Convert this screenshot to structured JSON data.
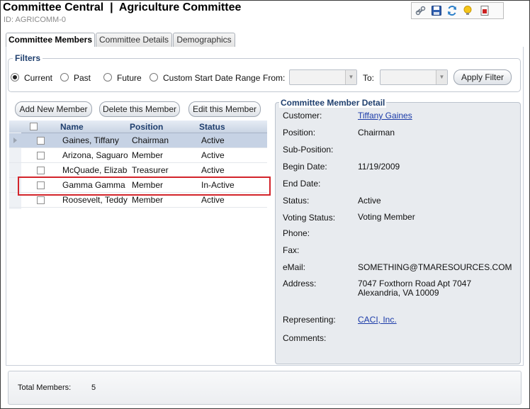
{
  "header": {
    "title": "Committee Central  |  Agriculture Committee",
    "id_text": "ID: AGRICOMM-0"
  },
  "toolbar": {
    "icons": [
      "link-icon",
      "save-icon",
      "refresh-icon",
      "tip-icon",
      "report-icon"
    ]
  },
  "tabs": [
    {
      "label": "Committee Members",
      "active": true
    },
    {
      "label": "Committee Details",
      "active": false
    },
    {
      "label": "Demographics",
      "active": false
    }
  ],
  "filters": {
    "legend": "Filters",
    "options": [
      {
        "label": "Current",
        "selected": true
      },
      {
        "label": "Past",
        "selected": false
      },
      {
        "label": "Future",
        "selected": false
      },
      {
        "label": "Custom Start Date Range",
        "selected": false
      }
    ],
    "from_label": "From:",
    "from_value": "",
    "to_label": "To:",
    "to_value": "",
    "apply_label": "Apply Filter"
  },
  "actions": {
    "add": "Add New Member",
    "delete": "Delete this Member",
    "edit": "Edit this Member"
  },
  "grid": {
    "columns": [
      "Name",
      "Position",
      "Status"
    ],
    "rows": [
      {
        "name": "Gaines, Tiffany",
        "position": "Chairman",
        "status": "Active",
        "selected": true
      },
      {
        "name": "Arizona, Saguaro",
        "position": "Member",
        "status": "Active",
        "selected": false
      },
      {
        "name": "McQuade, Elizabet",
        "position": "Treasurer",
        "status": "Active",
        "selected": false
      },
      {
        "name": "Gamma Gamma C",
        "position": "Member",
        "status": "In-Active",
        "selected": false
      },
      {
        "name": "Roosevelt, Teddy",
        "position": "Member",
        "status": "Active",
        "selected": false
      }
    ]
  },
  "detail": {
    "legend": "Committee Member Detail",
    "fields": {
      "customer_label": "Customer:",
      "customer_value": "Tiffany Gaines",
      "position_label": "Position:",
      "position_value": "Chairman",
      "subposition_label": "Sub-Position:",
      "subposition_value": "",
      "begin_label": "Begin Date:",
      "begin_value": "11/19/2009",
      "end_label": "End Date:",
      "end_value": "",
      "status_label": "Status:",
      "status_value": "Active",
      "voting_label": "Voting Status:",
      "voting_value": "Voting Member",
      "phone_label": "Phone:",
      "phone_value": "",
      "fax_label": "Fax:",
      "fax_value": "",
      "email_label": "eMail:",
      "email_value": "SOMETHING@TMARESOURCES.COM",
      "address_label": "Address:",
      "address_line1": "7047 Foxthorn Road Apt 7047",
      "address_line2": "Alexandria, VA 10009",
      "representing_label": "Representing:",
      "representing_value": "CACI, Inc.",
      "comments_label": "Comments:",
      "comments_value": ""
    }
  },
  "footer": {
    "total_label": "Total Members:",
    "total_value": "5"
  },
  "colors": {
    "accent": "#1f3f6e",
    "selected_row": "#c6d2e4",
    "highlight_border": "#d3242b",
    "link": "#1a3aa8"
  }
}
